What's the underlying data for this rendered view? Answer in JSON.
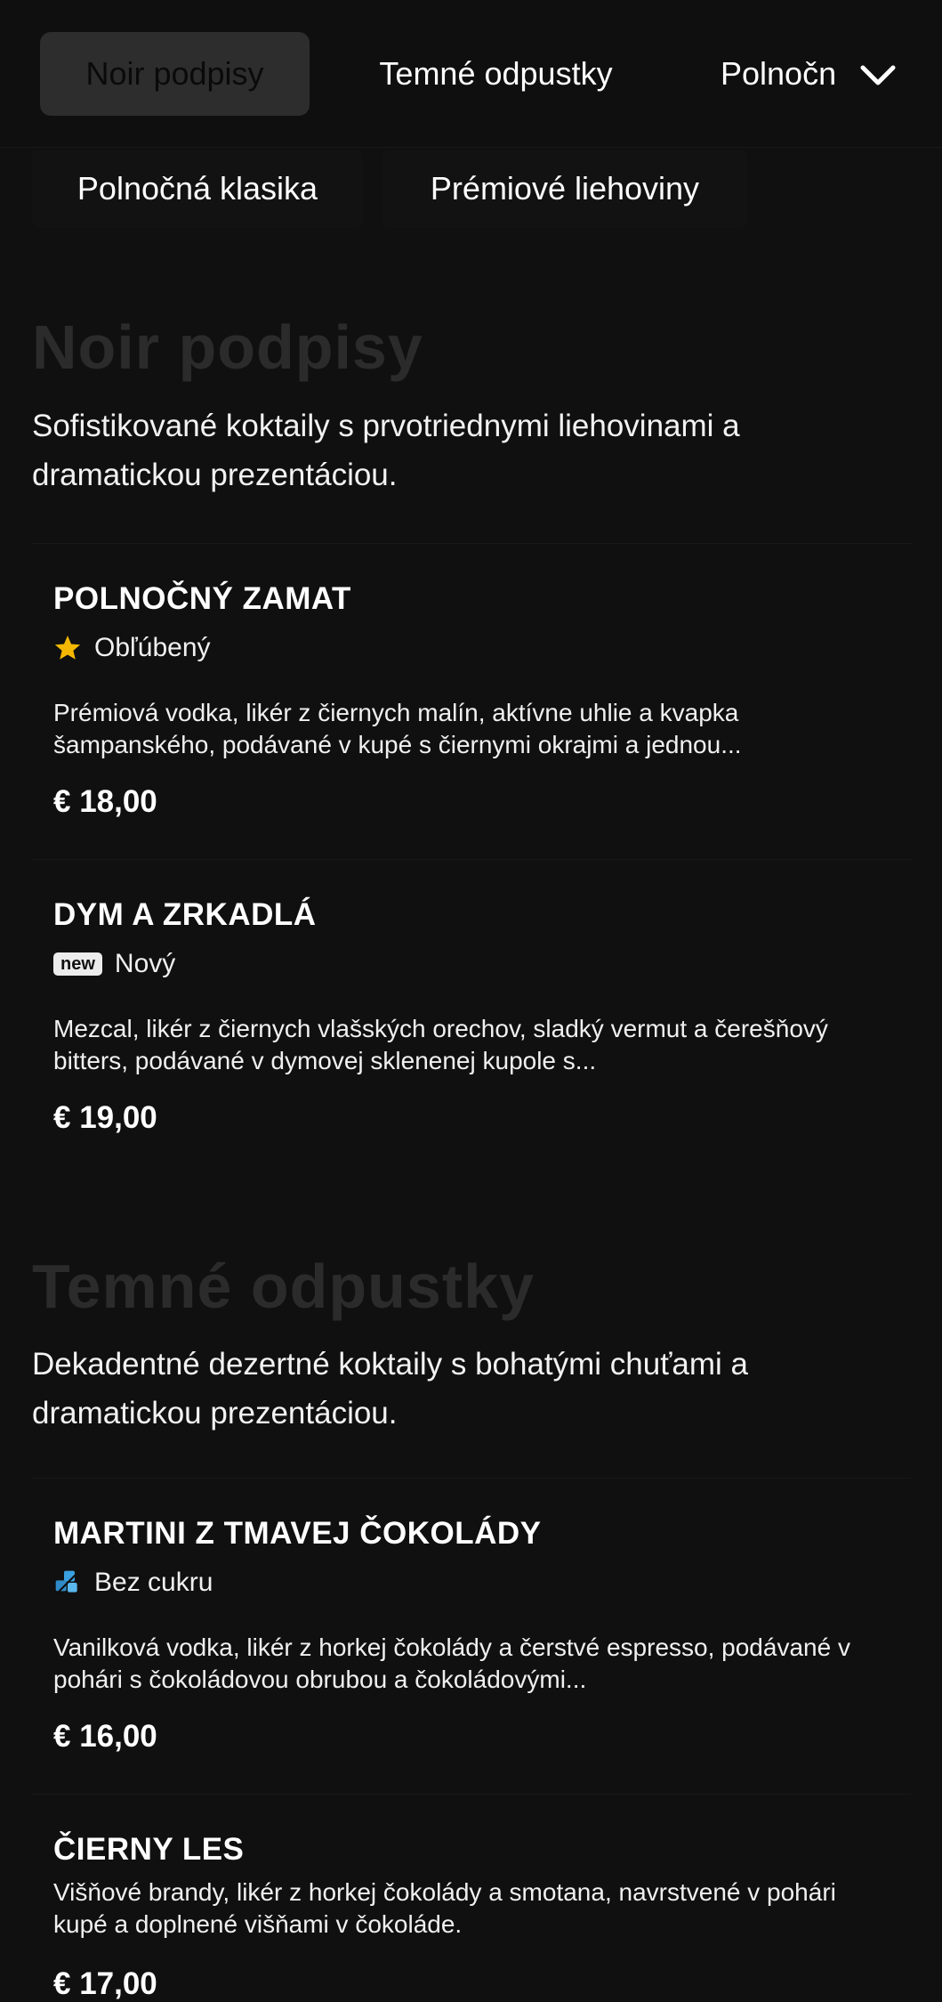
{
  "nav": {
    "tabs": [
      "Noir podpisy",
      "Temné odpustky",
      "Polnočná klasika"
    ],
    "subtabs": [
      "Polnočná klasika",
      "Prémiové liehoviny"
    ]
  },
  "sections": [
    {
      "title": "Noir podpisy",
      "description": "Sofistikované koktaily s prvotriednymi liehovinami a dramatickou prezentáciou.",
      "items": [
        {
          "name": "POLNOČNÝ ZAMAT",
          "tag_icon": "star-icon",
          "tag": "Obľúbený",
          "description": "Prémiová vodka, likér z čiernych malín, aktívne uhlie a kvapka šampanského, podávané v kupé s čiernymi okrajmi a jednou...",
          "price": "€ 18,00"
        },
        {
          "name": "DYM A ZRKADLÁ",
          "tag_icon": "new-badge-icon",
          "tag_badge": "new",
          "tag": "Nový",
          "description": "Mezcal, likér z čiernych vlašských orechov, sladký vermut a čerešňový bitters, podávané v dymovej sklenenej kupole s...",
          "price": "€ 19,00"
        }
      ]
    },
    {
      "title": "Temné odpustky",
      "description": "Dekadentné dezertné koktaily s bohatými chuťami a dramatickou prezentáciou.",
      "items": [
        {
          "name": "MARTINI Z TMAVEJ ČOKOLÁDY",
          "tag_icon": "sugar-free-icon",
          "tag": "Bez cukru",
          "description": "Vanilková vodka, likér z horkej čokolády a čerstvé espresso, podávané v pohári s čokoládovou obrubou a čokoládovými...",
          "price": "€ 16,00"
        },
        {
          "name": "ČIERNY LES",
          "description": "Višňové brandy, likér z horkej čokolády a smotana, navrstvené v pohári kupé a doplnené višňami v čokoláde.",
          "price": "€ 17,00"
        }
      ]
    }
  ],
  "colors": {
    "background": "#101010",
    "active_pill": "#2d2d2d",
    "section_title": "#2b2b2b",
    "star": "#f5b800",
    "sugar_free": "#3aa0e0"
  }
}
